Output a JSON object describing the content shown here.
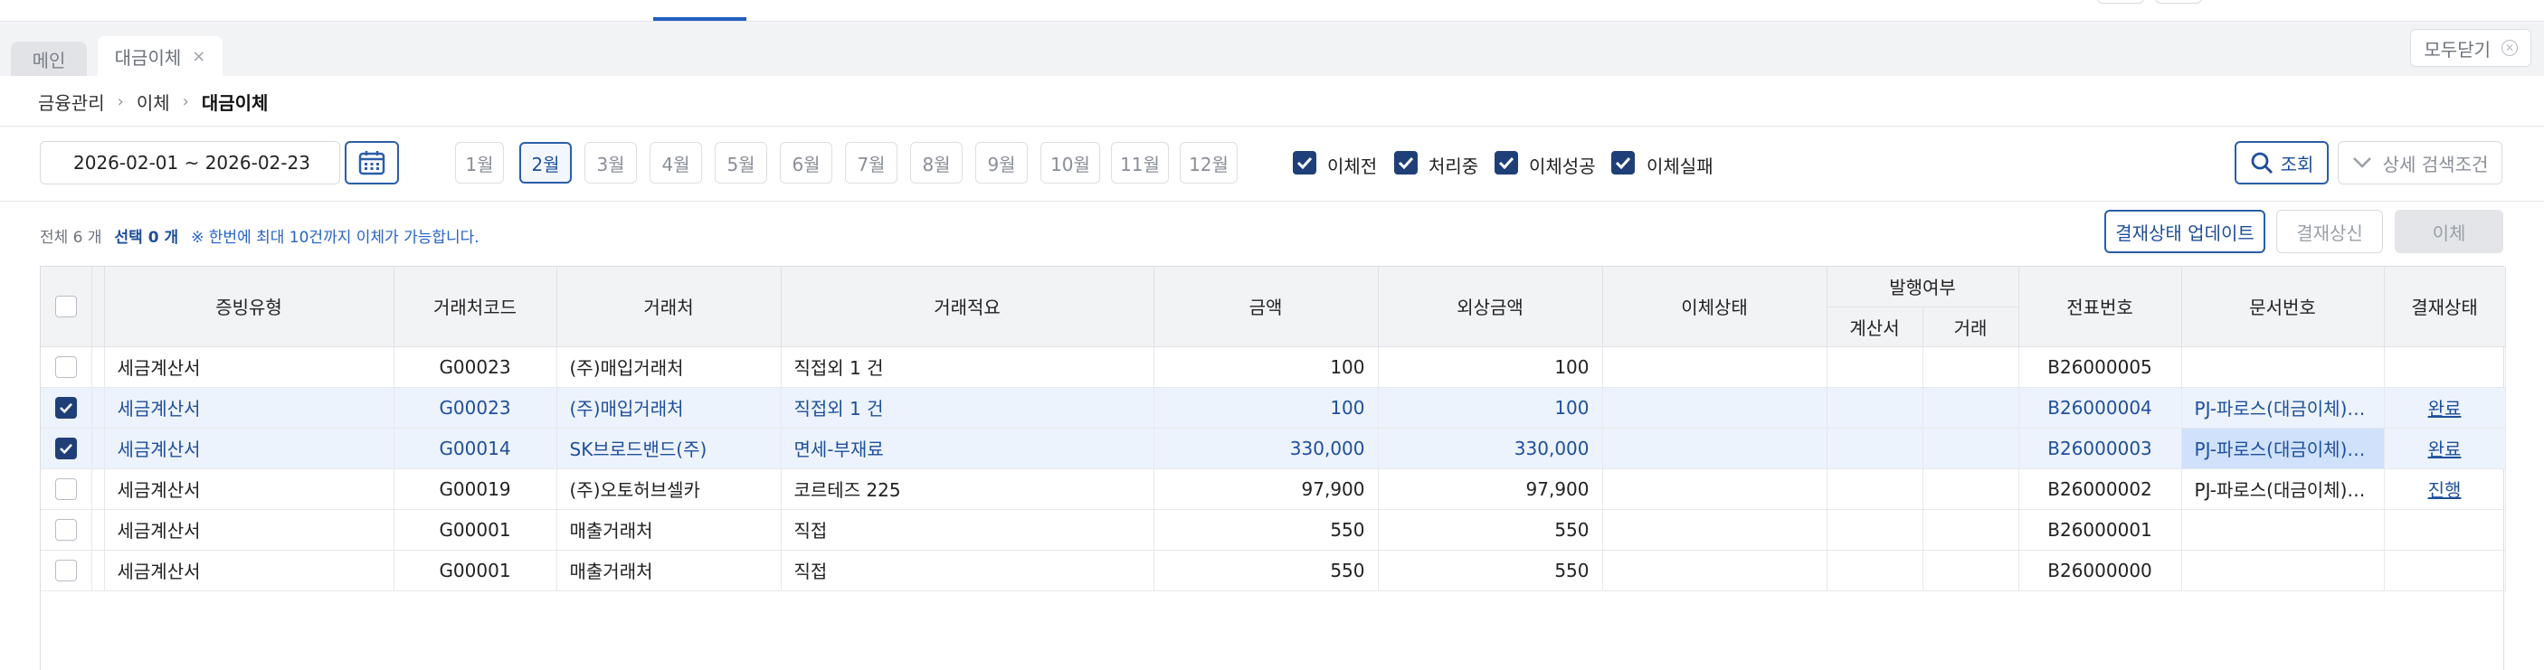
{
  "tabs": {
    "main": "메인",
    "transfer": "대금이체",
    "close_all": "모두닫기"
  },
  "breadcrumb": [
    "금융관리",
    "이체",
    "대금이체"
  ],
  "filter": {
    "date_range": "2026-02-01 ~ 2026-02-23",
    "months": [
      "1월",
      "2월",
      "3월",
      "4월",
      "5월",
      "6월",
      "7월",
      "8월",
      "9월",
      "10월",
      "11월",
      "12월"
    ],
    "selected_month": "2월",
    "status_checks": [
      {
        "label": "이체전",
        "checked": true
      },
      {
        "label": "처리중",
        "checked": true
      },
      {
        "label": "이체성공",
        "checked": true
      },
      {
        "label": "이체실패",
        "checked": true
      }
    ],
    "search_label": "조회",
    "detail_label": "상세 검색조건"
  },
  "summary": {
    "total": "전체 6 개",
    "selected": "선택 0 개",
    "note": "※ 한번에 최대 10건까지 이체가 가능합니다."
  },
  "actions": {
    "update": "결재상태 업데이트",
    "resend": "결재상신",
    "transfer": "이체"
  },
  "table": {
    "headers": {
      "evidence": "증빙유형",
      "code": "거래처코드",
      "vendor": "거래처",
      "summary": "거래적요",
      "amount": "금액",
      "foreign": "외상금액",
      "transfer_status": "이체상태",
      "issued": "발행여부",
      "invoice": "계산서",
      "trade": "거래",
      "slip": "전표번호",
      "doc": "문서번호",
      "approval": "결재상태"
    },
    "rows": [
      {
        "checked": false,
        "evidence": "세금계산서",
        "code": "G00023",
        "vendor": "(주)매입거래처",
        "summary": "직접외 1 건",
        "amount": "100",
        "foreign": "100",
        "transfer_status": "",
        "invoice": "",
        "trade": "",
        "slip": "B26000005",
        "doc": "",
        "approval": ""
      },
      {
        "checked": true,
        "evidence": "세금계산서",
        "code": "G00023",
        "vendor": "(주)매입거래처",
        "summary": "직접외 1 건",
        "amount": "100",
        "foreign": "100",
        "transfer_status": "",
        "invoice": "",
        "trade": "",
        "slip": "B26000004",
        "doc": "PJ-파로스(대금이체)-...",
        "approval": "완료"
      },
      {
        "checked": true,
        "evidence": "세금계산서",
        "code": "G00014",
        "vendor": "SK브로드밴드(주)",
        "summary": "면세-부재료",
        "amount": "330,000",
        "foreign": "330,000",
        "transfer_status": "",
        "invoice": "",
        "trade": "",
        "slip": "B26000003",
        "doc": "PJ-파로스(대금이체)-...",
        "approval": "완료"
      },
      {
        "checked": false,
        "evidence": "세금계산서",
        "code": "G00019",
        "vendor": "(주)오토허브셀카",
        "summary": "코르테즈 225",
        "amount": "97,900",
        "foreign": "97,900",
        "transfer_status": "",
        "invoice": "",
        "trade": "",
        "slip": "B26000002",
        "doc": "PJ-파로스(대금이체)-...",
        "approval": "진행"
      },
      {
        "checked": false,
        "evidence": "세금계산서",
        "code": "G00001",
        "vendor": "매출거래처",
        "summary": "직접",
        "amount": "550",
        "foreign": "550",
        "transfer_status": "",
        "invoice": "",
        "trade": "",
        "slip": "B26000001",
        "doc": "",
        "approval": ""
      },
      {
        "checked": false,
        "evidence": "세금계산서",
        "code": "G00001",
        "vendor": "매출거래처",
        "summary": "직접",
        "amount": "550",
        "foreign": "550",
        "transfer_status": "",
        "invoice": "",
        "trade": "",
        "slip": "B26000000",
        "doc": "",
        "approval": ""
      }
    ]
  },
  "colors": {
    "primary": "#1e4f9c",
    "checkbox": "#1f3f78",
    "selected_row": "#edf3fc",
    "highlight_cell": "#cfe1fb",
    "header_bg": "#f2f3f5"
  }
}
